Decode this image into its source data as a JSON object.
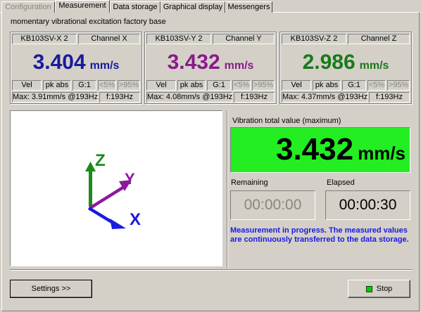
{
  "tabs": [
    {
      "label": "Configuration",
      "state": "disabled"
    },
    {
      "label": "Measurement",
      "state": "active"
    },
    {
      "label": "Data storage",
      "state": "normal"
    },
    {
      "label": "Graphical display",
      "state": "normal"
    },
    {
      "label": "Messengers",
      "state": "normal"
    }
  ],
  "subtitle": "momentary vibrational excitation factory  base",
  "channels": [
    {
      "sensor": "KB103SV-X 2",
      "channel": "Channel X",
      "value": "3.404",
      "unit": "mm/s",
      "color": "#1a1a9a",
      "mode": "Vel",
      "peak": "pk abs",
      "gain": "G:1",
      "low": "<5%",
      "high": ">95%",
      "max": "Max: 3.91mm/s @193Hz",
      "freq": "f:193Hz"
    },
    {
      "sensor": "KB103SV-Y 2",
      "channel": "Channel Y",
      "value": "3.432",
      "unit": "mm/s",
      "color": "#8a1a8a",
      "mode": "Vel",
      "peak": "pk abs",
      "gain": "G:1",
      "low": "<5%",
      "high": ">95%",
      "max": "Max: 4.08mm/s @193Hz",
      "freq": "f:193Hz"
    },
    {
      "sensor": "KB103SV-Z 2",
      "channel": "Channel Z",
      "value": "2.986",
      "unit": "mm/s",
      "color": "#1a7a1a",
      "mode": "Vel",
      "peak": "pk abs",
      "gain": "G:1",
      "low": "<5%",
      "high": ">95%",
      "max": "Max: 4.37mm/s @193Hz",
      "freq": "f:193Hz"
    }
  ],
  "axes": {
    "z_label": "Z",
    "y_label": "Y",
    "x_label": "X",
    "z_color": "#1a8a1a",
    "y_color": "#8a1a9a",
    "x_color": "#1a1ae0"
  },
  "total": {
    "label": "Vibration total value (maximum)",
    "value": "3.432",
    "unit": "mm/s",
    "bg_color": "#22ee22"
  },
  "remaining": {
    "label": "Remaining",
    "value": "00:00:00"
  },
  "elapsed": {
    "label": "Elapsed",
    "value": "00:00:30"
  },
  "status_message": "Measurement in progress. The measured values are continuously transferred to the data storage.",
  "buttons": {
    "settings": "Settings >>",
    "stop": "Stop"
  },
  "icons": {
    "stop": "green-square-icon"
  }
}
